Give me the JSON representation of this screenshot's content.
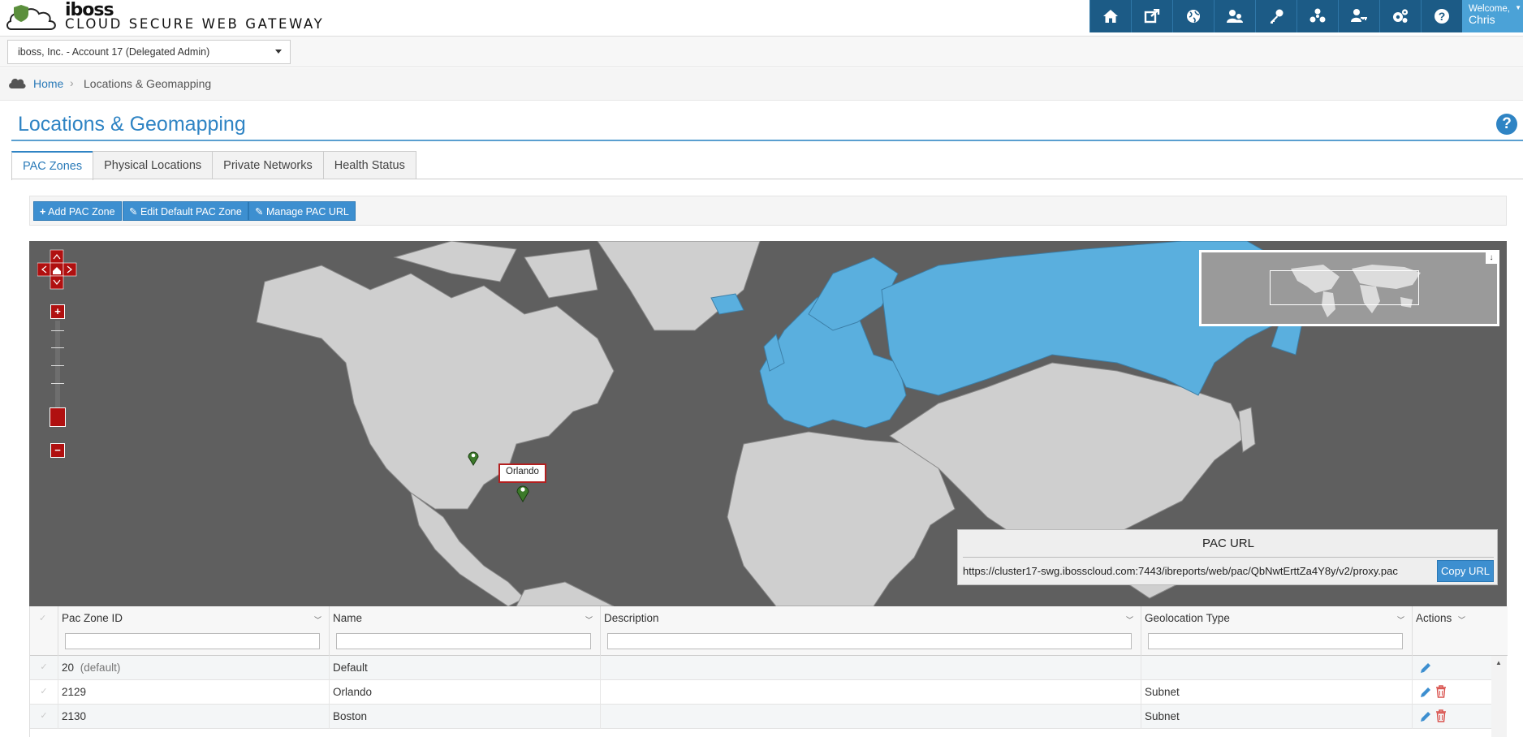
{
  "header": {
    "brand_word": "iboss",
    "brand_title": "CLOUD SECURE WEB GATEWAY",
    "nav_icons": [
      "home-icon",
      "external-link-icon",
      "globe-icon",
      "users-icon",
      "key-icon",
      "network-icon",
      "user-key-icon",
      "gears-icon",
      "help-icon"
    ],
    "welcome_label": "Welcome,",
    "welcome_name": "Chris"
  },
  "account": {
    "selected": "iboss, Inc. - Account 17 (Delegated Admin)"
  },
  "breadcrumb": {
    "home": "Home",
    "separator": "›",
    "current": "Locations & Geomapping"
  },
  "page": {
    "title": "Locations & Geomapping",
    "help": "?"
  },
  "tabs": [
    {
      "label": "PAC Zones",
      "active": true
    },
    {
      "label": "Physical Locations"
    },
    {
      "label": "Private Networks"
    },
    {
      "label": "Health Status"
    }
  ],
  "toolbar": {
    "add_label": "Add PAC Zone",
    "edit_label": "Edit Default PAC Zone",
    "manage_label": "Manage PAC URL"
  },
  "map": {
    "tooltip": "Orlando",
    "land_color": "#cfcfcf",
    "highlight_color": "#5aafde",
    "water_color": "#5f5f5f"
  },
  "pac": {
    "title": "PAC URL",
    "url": "https://cluster17-swg.ibosscloud.com:7443/ibreports/web/pac/QbNwtErttZa4Y8y/v2/proxy.pac",
    "copy_label": "Copy URL"
  },
  "grid": {
    "columns": [
      "Pac Zone ID",
      "Name",
      "Description",
      "Geolocation Type",
      "Actions"
    ],
    "rows": [
      {
        "id": "20",
        "tag": "(default)",
        "name": "Default",
        "description": "",
        "geo": ""
      },
      {
        "id": "2129",
        "tag": "",
        "name": "Orlando",
        "description": "",
        "geo": "Subnet"
      },
      {
        "id": "2130",
        "tag": "",
        "name": "Boston",
        "description": "",
        "geo": "Subnet"
      }
    ]
  }
}
